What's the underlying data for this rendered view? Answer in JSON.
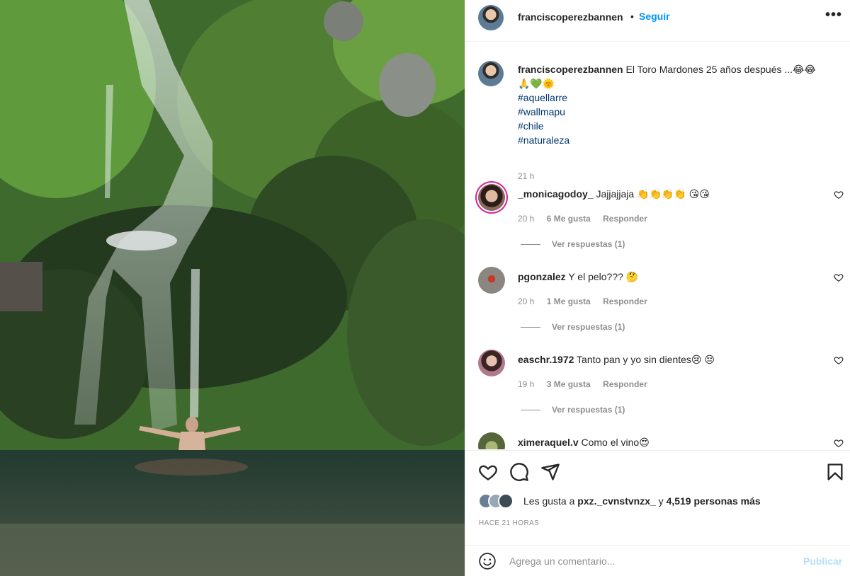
{
  "post": {
    "image_alt": "",
    "author": "franciscoperezbannen",
    "separator": "•",
    "follow_label": "Seguir",
    "more_icon": "more-options-icon"
  },
  "caption": {
    "username": "franciscoperezbannen",
    "text": "El Toro Mardones 25 años después ...😂😂",
    "emoji_line": "🙏💚🌞",
    "hashtags": [
      "#aquellarre",
      "#wallmapu",
      "#chile",
      "#naturaleza"
    ],
    "time": "21 h"
  },
  "comments": [
    {
      "username": "_monicagodoy_",
      "text": "Jajjajjaja 👏👏👏👏 😘😘",
      "time": "20 h",
      "likes": "6 Me gusta",
      "reply_label": "Responder",
      "replies": "Ver respuestas (1)",
      "avatar_color": "#8a6a5a"
    },
    {
      "username": "pgonzalez",
      "text": "Y el pelo??? 🤔",
      "time": "20 h",
      "likes": "1 Me gusta",
      "reply_label": "Responder",
      "replies": "Ver respuestas (1)",
      "avatar_color": "#7a6a66"
    },
    {
      "username": "easchr.1972",
      "text": "Tanto pan y yo sin dientes😢 😔",
      "time": "19 h",
      "likes": "3 Me gusta",
      "reply_label": "Responder",
      "replies": "Ver respuestas (1)",
      "avatar_color": "#b07a8a"
    },
    {
      "username": "ximeraquel.v",
      "text": "Como el vino😍",
      "time": "",
      "likes": "",
      "reply_label": "",
      "replies": "",
      "avatar_color": "#7e8f5a"
    }
  ],
  "actions": {
    "like_icon": "heart-icon",
    "comment_icon": "comment-icon",
    "share_icon": "share-icon",
    "save_icon": "bookmark-icon"
  },
  "likes": {
    "prefix": "Les gusta a",
    "user": "pxz._cvnstvnzx_",
    "conj": "y",
    "count": "4,519 personas más",
    "avatar_colors": [
      "#6a7f96",
      "#9aa7b4",
      "#3e4a56"
    ]
  },
  "posted_ago": "HACE 21 HORAS",
  "add_comment": {
    "placeholder": "Agrega un comentario...",
    "publish_label": "Publicar"
  }
}
